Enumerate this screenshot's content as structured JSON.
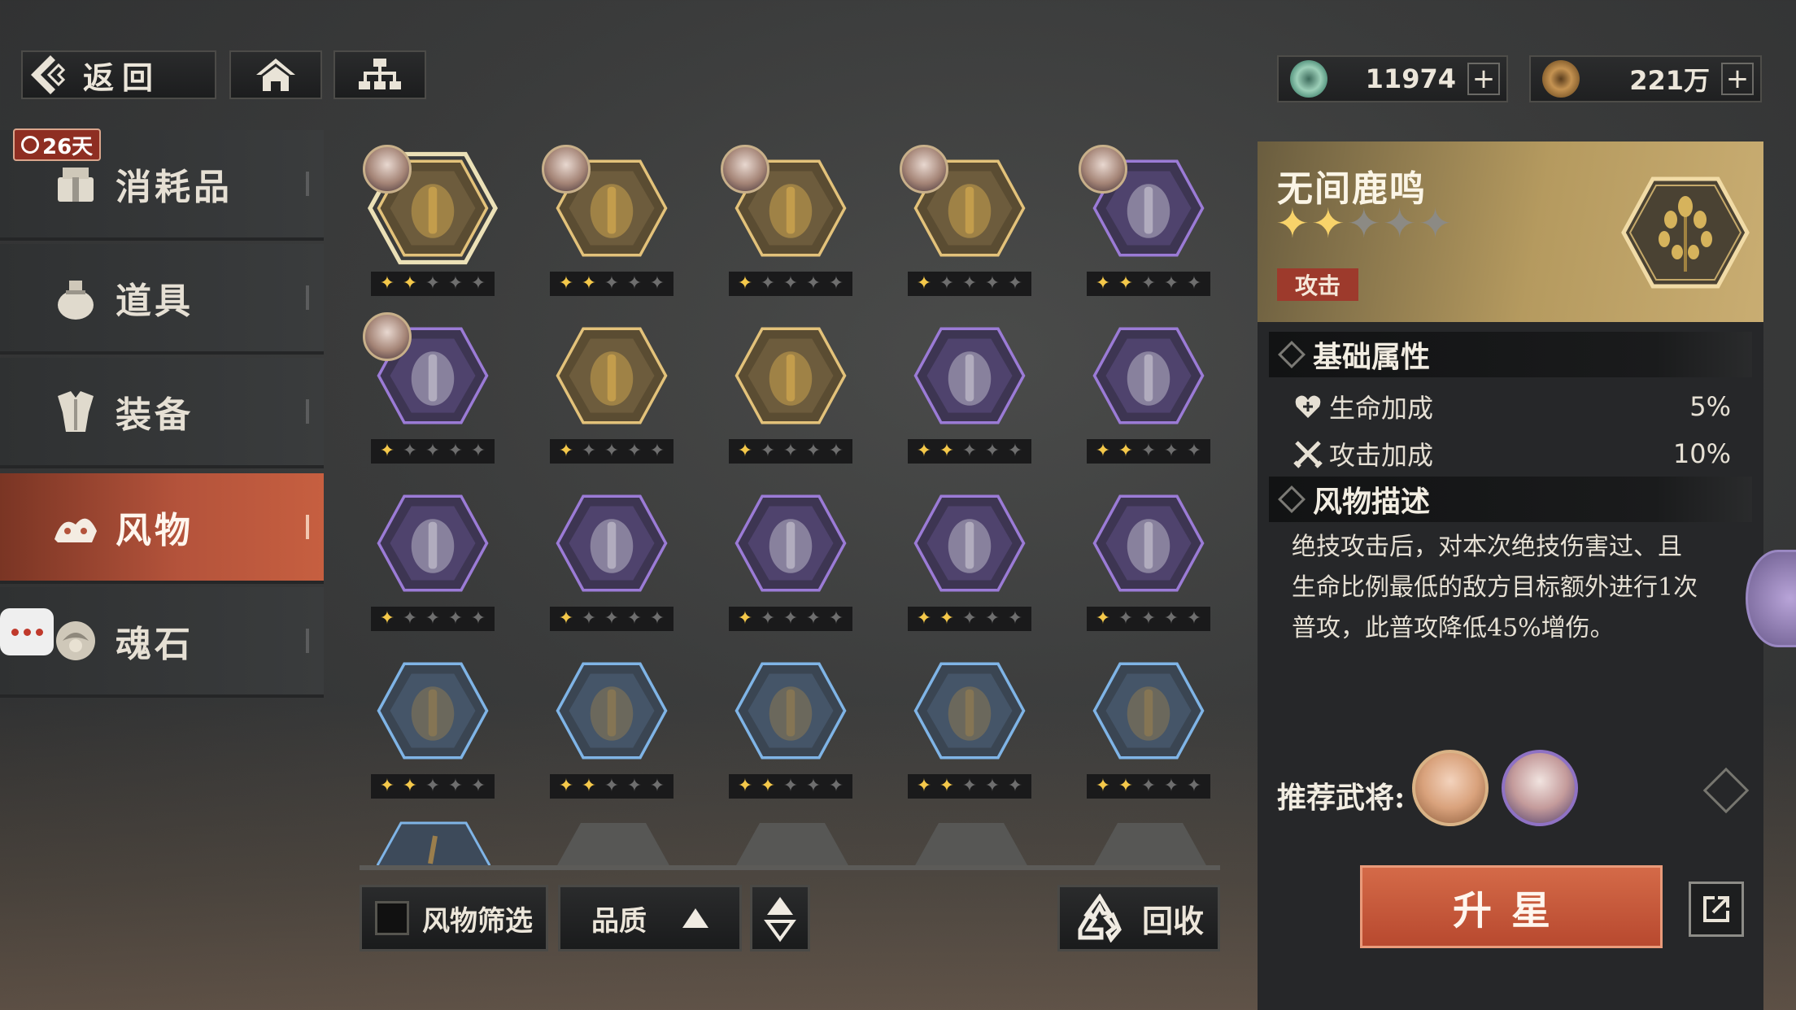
{
  "topbar": {
    "back_label": "返回",
    "currency_jade": "11974",
    "currency_copper": "221万"
  },
  "sidebar": {
    "timer": "26天",
    "items": [
      {
        "label": "消耗品",
        "icon": "package-icon",
        "active": false
      },
      {
        "label": "道具",
        "icon": "pouch-icon",
        "active": false
      },
      {
        "label": "装备",
        "icon": "armor-icon",
        "active": false
      },
      {
        "label": "风物",
        "icon": "artifact-icon",
        "active": true
      },
      {
        "label": "魂石",
        "icon": "soulstone-icon",
        "active": false
      }
    ]
  },
  "grid": {
    "items": [
      {
        "row": 0,
        "col": 0,
        "rarity": "gold",
        "stars": 2,
        "selected": true,
        "avatar": true,
        "art": "golden-ginkgo-tree"
      },
      {
        "row": 0,
        "col": 1,
        "rarity": "gold",
        "stars": 2,
        "avatar": true,
        "art": "wooden-carving"
      },
      {
        "row": 0,
        "col": 2,
        "rarity": "gold",
        "stars": 1,
        "avatar": true,
        "art": "crossbow"
      },
      {
        "row": 0,
        "col": 3,
        "rarity": "gold",
        "stars": 1,
        "avatar": true,
        "art": "bronze-drum"
      },
      {
        "row": 0,
        "col": 4,
        "rarity": "purple",
        "stars": 2,
        "avatar": true,
        "art": "jade-ruyi"
      },
      {
        "row": 1,
        "col": 0,
        "rarity": "purple",
        "stars": 1,
        "avatar": true,
        "art": "command-token"
      },
      {
        "row": 1,
        "col": 1,
        "rarity": "gold",
        "stars": 1,
        "art": "bracelets"
      },
      {
        "row": 1,
        "col": 2,
        "rarity": "gold",
        "stars": 1,
        "art": "golden-tripod-cup"
      },
      {
        "row": 1,
        "col": 3,
        "rarity": "purple",
        "stars": 2,
        "art": "short-sword"
      },
      {
        "row": 1,
        "col": 4,
        "rarity": "purple",
        "stars": 2,
        "art": "horse-rider-statue"
      },
      {
        "row": 2,
        "col": 0,
        "rarity": "purple",
        "stars": 1,
        "art": "jade-seal"
      },
      {
        "row": 2,
        "col": 1,
        "rarity": "purple",
        "stars": 1,
        "art": "silver-bells"
      },
      {
        "row": 2,
        "col": 2,
        "rarity": "purple",
        "stars": 1,
        "art": "horsetail-whisk"
      },
      {
        "row": 2,
        "col": 3,
        "rarity": "purple",
        "stars": 2,
        "art": "armored-horse"
      },
      {
        "row": 2,
        "col": 4,
        "rarity": "purple",
        "stars": 1,
        "art": "bronze-censer"
      },
      {
        "row": 3,
        "col": 0,
        "rarity": "blue",
        "stars": 2,
        "art": "curved-blade"
      },
      {
        "row": 3,
        "col": 1,
        "rarity": "blue",
        "stars": 2,
        "art": "dagger-axe"
      },
      {
        "row": 3,
        "col": 2,
        "rarity": "blue",
        "stars": 2,
        "art": "bronze-cauldron"
      },
      {
        "row": 3,
        "col": 3,
        "rarity": "blue",
        "stars": 2,
        "art": "black-jar"
      },
      {
        "row": 3,
        "col": 4,
        "rarity": "blue",
        "stars": 2,
        "art": "trident-spear"
      }
    ]
  },
  "controls": {
    "filter_label": "风物筛选",
    "quality_label": "品质",
    "recycle_label": "回收"
  },
  "detail": {
    "name": "无间鹿鸣",
    "stars": 2,
    "max_stars": 5,
    "tag": "攻击",
    "base_attr_title": "基础属性",
    "attrs": [
      {
        "name": "生命加成",
        "value": "5%",
        "icon": "heart-icon"
      },
      {
        "name": "攻击加成",
        "value": "10%",
        "icon": "crossed-swords-icon"
      }
    ],
    "desc_title": "风物描述",
    "desc_lines": [
      "绝技攻击后，对本次绝技伤害过、且",
      "生命比例最低的敌方目标额外进行1次",
      "普攻，此普攻降低45%增伤。"
    ],
    "recommend_label": "推荐武将:",
    "upgrade_label": "升星"
  },
  "colors": {
    "accent": "#c65f40",
    "gold_rarity": "#e3c27a",
    "purple_rarity": "#9b7bd6",
    "blue_rarity": "#7fb4e6",
    "star_on": "#f4c84a"
  }
}
